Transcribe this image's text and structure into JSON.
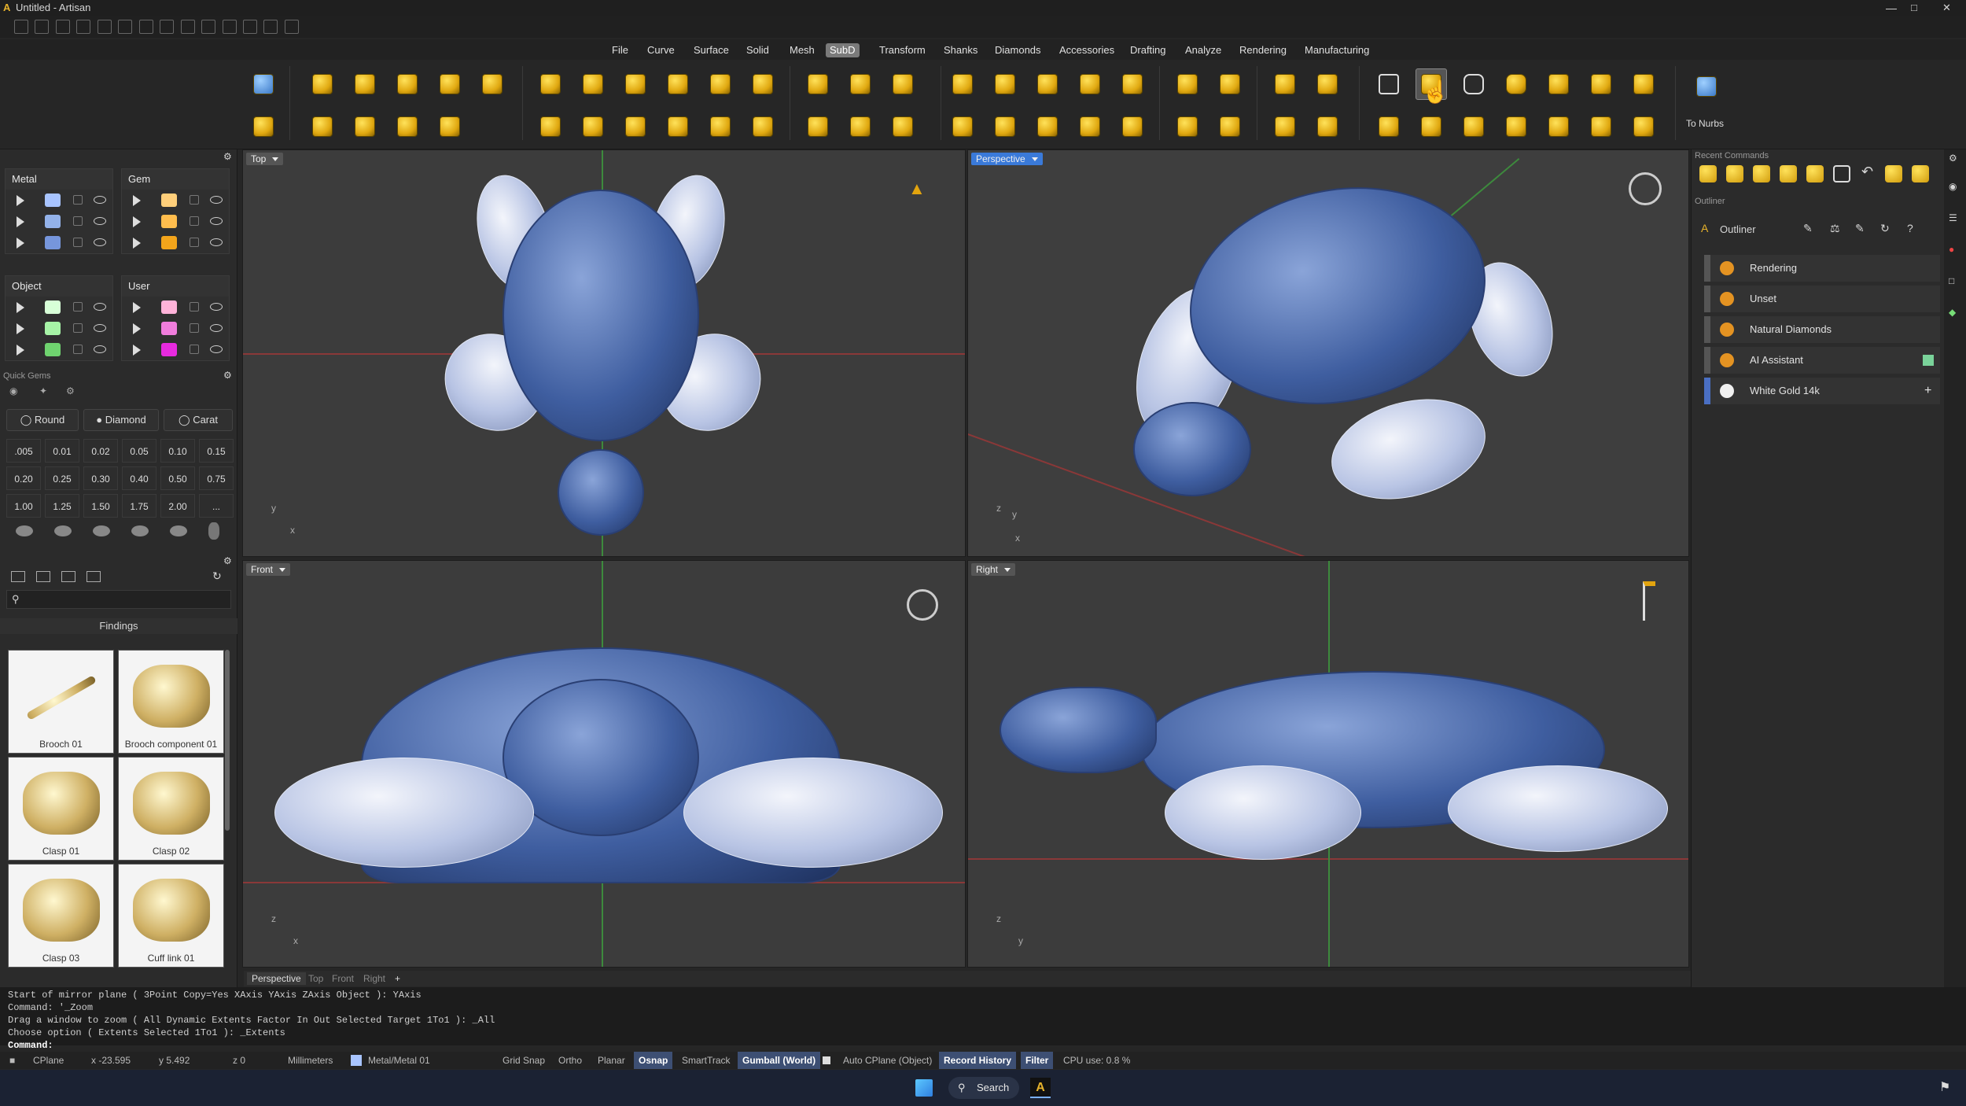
{
  "window": {
    "title": "Untitled - Artisan"
  },
  "menu": {
    "items": [
      "File",
      "Curve",
      "Surface",
      "Solid",
      "Mesh",
      "SubD",
      "Transform",
      "Shanks",
      "Diamonds",
      "Accessories",
      "Drafting",
      "Analyze",
      "Rendering",
      "Manufacturing"
    ],
    "active": "SubD"
  },
  "ribbon": {
    "to_nurbs_label": "To Nurbs"
  },
  "layers": {
    "metal": {
      "title": "Metal",
      "colors": [
        "#a8c4ff",
        "#93b2ea",
        "#7696dc"
      ]
    },
    "gem": {
      "title": "Gem",
      "colors": [
        "#ffcf7a",
        "#ffbd4d",
        "#f3a51b"
      ]
    },
    "object": {
      "title": "Object",
      "colors": [
        "#d8ffd8",
        "#a6f3a6",
        "#6fd36f"
      ]
    },
    "user": {
      "title": "User",
      "colors": [
        "#ffb3d9",
        "#f07ddc",
        "#e72adf"
      ]
    }
  },
  "quick_gems": {
    "title": "Quick Gems",
    "shape": "Round",
    "type": "Diamond",
    "unit": "Carat",
    "carats": [
      ".005",
      "0.01",
      "0.02",
      "0.05",
      "0.10",
      "0.15",
      "0.20",
      "0.25",
      "0.30",
      "0.40",
      "0.50",
      "0.75",
      "1.00",
      "1.25",
      "1.50",
      "1.75",
      "2.00",
      "..."
    ]
  },
  "library": {
    "category": "Findings",
    "items": [
      "Brooch 01",
      "Brooch component 01",
      "Clasp 01",
      "Clasp 02",
      "Clasp 03",
      "Cuff link 01"
    ]
  },
  "viewports": {
    "top": "Top",
    "perspective": "Perspective",
    "front": "Front",
    "right": "Right"
  },
  "viewport_tabs": [
    "Perspective",
    "Top",
    "Front",
    "Right",
    "+"
  ],
  "recent_commands": {
    "title": "Recent Commands"
  },
  "outliner": {
    "section": "Outliner",
    "title": "Outliner",
    "items": [
      {
        "label": "Rendering",
        "color": "#e49322"
      },
      {
        "label": "Unset",
        "color": "#e49322"
      },
      {
        "label": "Natural Diamonds",
        "color": "#e49322"
      },
      {
        "label": "AI Assistant",
        "color": "#e49322"
      },
      {
        "label": "White Gold 14k",
        "color": "#f0f0f0"
      }
    ]
  },
  "command_history": [
    "Start of mirror plane ( 3Point  Copy=Yes  XAxis  YAxis  ZAxis  Object ): YAxis",
    "Command: '_Zoom",
    "Drag a window to zoom ( All  Dynamic  Extents  Factor  In  Out  Selected  Target  1To1 ): _All",
    "Choose option ( Extents  Selected  1To1 ): _Extents"
  ],
  "command_prompt": "Command:",
  "status": {
    "cplane": "CPlane",
    "x": "x -23.595",
    "y": "y 5.492",
    "z": "z 0",
    "units": "Millimeters",
    "layer": "Metal/Metal 01",
    "toggles": [
      "Grid Snap",
      "Ortho",
      "Planar",
      "Osnap",
      "SmartTrack",
      "Gumball (World)",
      "Auto CPlane (Object)",
      "Record History",
      "Filter"
    ],
    "active_toggles": [
      "Osnap",
      "Gumball (World)",
      "Record History",
      "Filter"
    ],
    "cpu": "CPU use: 0.8 %"
  },
  "taskbar": {
    "search": "Search"
  }
}
